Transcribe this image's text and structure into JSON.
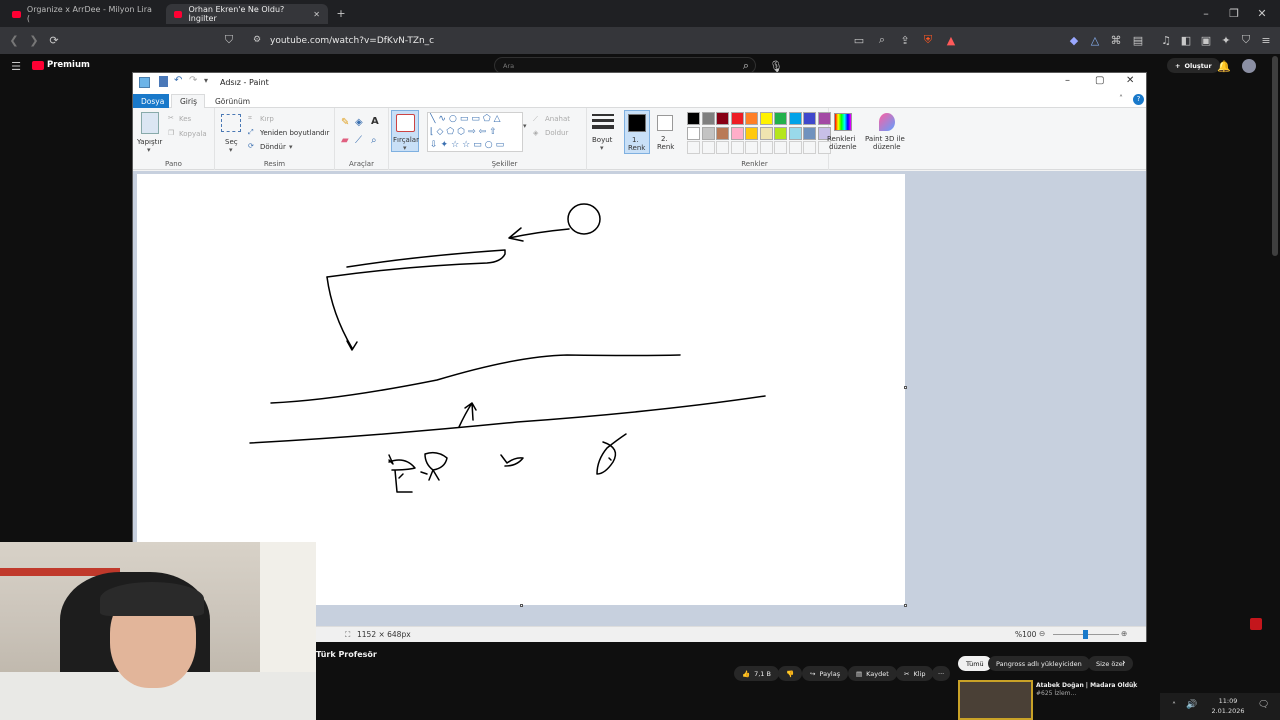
{
  "browser": {
    "tabs": [
      {
        "label": "Organize x ArrDee - Milyon Lira (",
        "active": false
      },
      {
        "label": "Orhan Ekren'e Ne Oldu? İngilter",
        "active": true
      }
    ],
    "new_tab": "+",
    "url": "youtube.com/watch?v=DfKvN-TZn_c"
  },
  "youtube": {
    "logo": "Premium",
    "search_placeholder": "Ara",
    "create_label": "Oluştur",
    "channel": "Türk Profesör",
    "actions": {
      "like_count": "7,1 B",
      "share": "Paylaş",
      "save": "Kaydet",
      "clip": "Klip",
      "more": "···"
    },
    "filter_chips": [
      "Tümü",
      "Pangross adlı yükleyiciden",
      "Size özel"
    ],
    "rec_title": "Atabek Doğan | Madara Oldük",
    "rec_sub": "#625 İzlem..."
  },
  "paint": {
    "title": "Adsız - Paint",
    "menu": {
      "file": "Dosya",
      "home": "Giriş",
      "view": "Görünüm"
    },
    "clipboard": {
      "paste": "Yapıştır",
      "cut": "Kes",
      "copy": "Kopyala",
      "group": "Pano"
    },
    "image": {
      "select": "Seç",
      "crop": "Kırp",
      "resize": "Yeniden boyutlandır",
      "rotate": "Döndür",
      "group": "Resim"
    },
    "tools": {
      "group": "Araçlar"
    },
    "brushes": {
      "label": "Fırçalar"
    },
    "shapes": {
      "outline": "Anahat",
      "fill": "Doldur",
      "group": "Şekiller"
    },
    "size": {
      "label": "Boyut"
    },
    "color1": {
      "label": "1.",
      "sub": "Renk"
    },
    "color2": {
      "label": "2.",
      "sub": "Renk"
    },
    "colors_group": "Renkler",
    "edit_colors": {
      "line1": "Renkleri",
      "line2": "düzenle"
    },
    "paint3d": {
      "line1": "Paint 3D ile",
      "line2": "düzenle"
    },
    "palette": [
      "#000000",
      "#7f7f7f",
      "#880015",
      "#ed1c24",
      "#ff7f27",
      "#fff200",
      "#22b14c",
      "#00a2e8",
      "#3f48cc",
      "#a349a4",
      "#ffffff",
      "#c3c3c3",
      "#b97a57",
      "#ffaec9",
      "#ffc90e",
      "#efe4b0",
      "#b5e61d",
      "#99d9ea",
      "#7092be",
      "#c8bfe7"
    ],
    "status": {
      "dims": "1152 × 648px",
      "zoom": "%100"
    }
  },
  "taskbar": {
    "time": "11:09",
    "date": "2.01.2026"
  }
}
